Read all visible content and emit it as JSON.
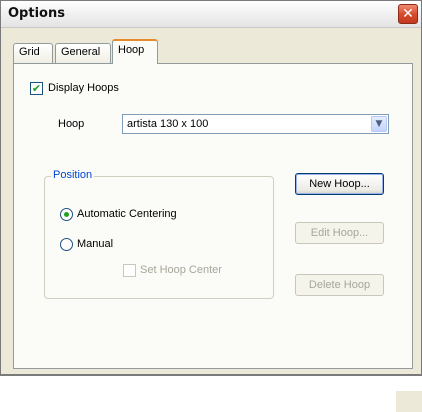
{
  "window": {
    "title": "Options",
    "close_glyph": "✕"
  },
  "tabs": [
    {
      "label": "Grid",
      "active": false
    },
    {
      "label": "General",
      "active": false
    },
    {
      "label": "Hoop",
      "active": true
    }
  ],
  "display_hoops": {
    "label": "Display Hoops",
    "checked": true,
    "check_glyph": "✔"
  },
  "hoop": {
    "label": "Hoop",
    "value": "artista 130 x 100",
    "arrow": "▼"
  },
  "position": {
    "legend": "Position",
    "automatic": {
      "label": "Automatic Centering",
      "selected": true
    },
    "manual": {
      "label": "Manual",
      "selected": false
    },
    "set_center": {
      "label": "Set Hoop Center",
      "enabled": false
    }
  },
  "buttons": {
    "new_hoop": "New Hoop...",
    "edit_hoop": "Edit Hoop...",
    "delete_hoop": "Delete Hoop"
  },
  "colors": {
    "accent_tab": "#e68b2c",
    "group_legend": "#0046d5",
    "close": "#d5482b"
  }
}
